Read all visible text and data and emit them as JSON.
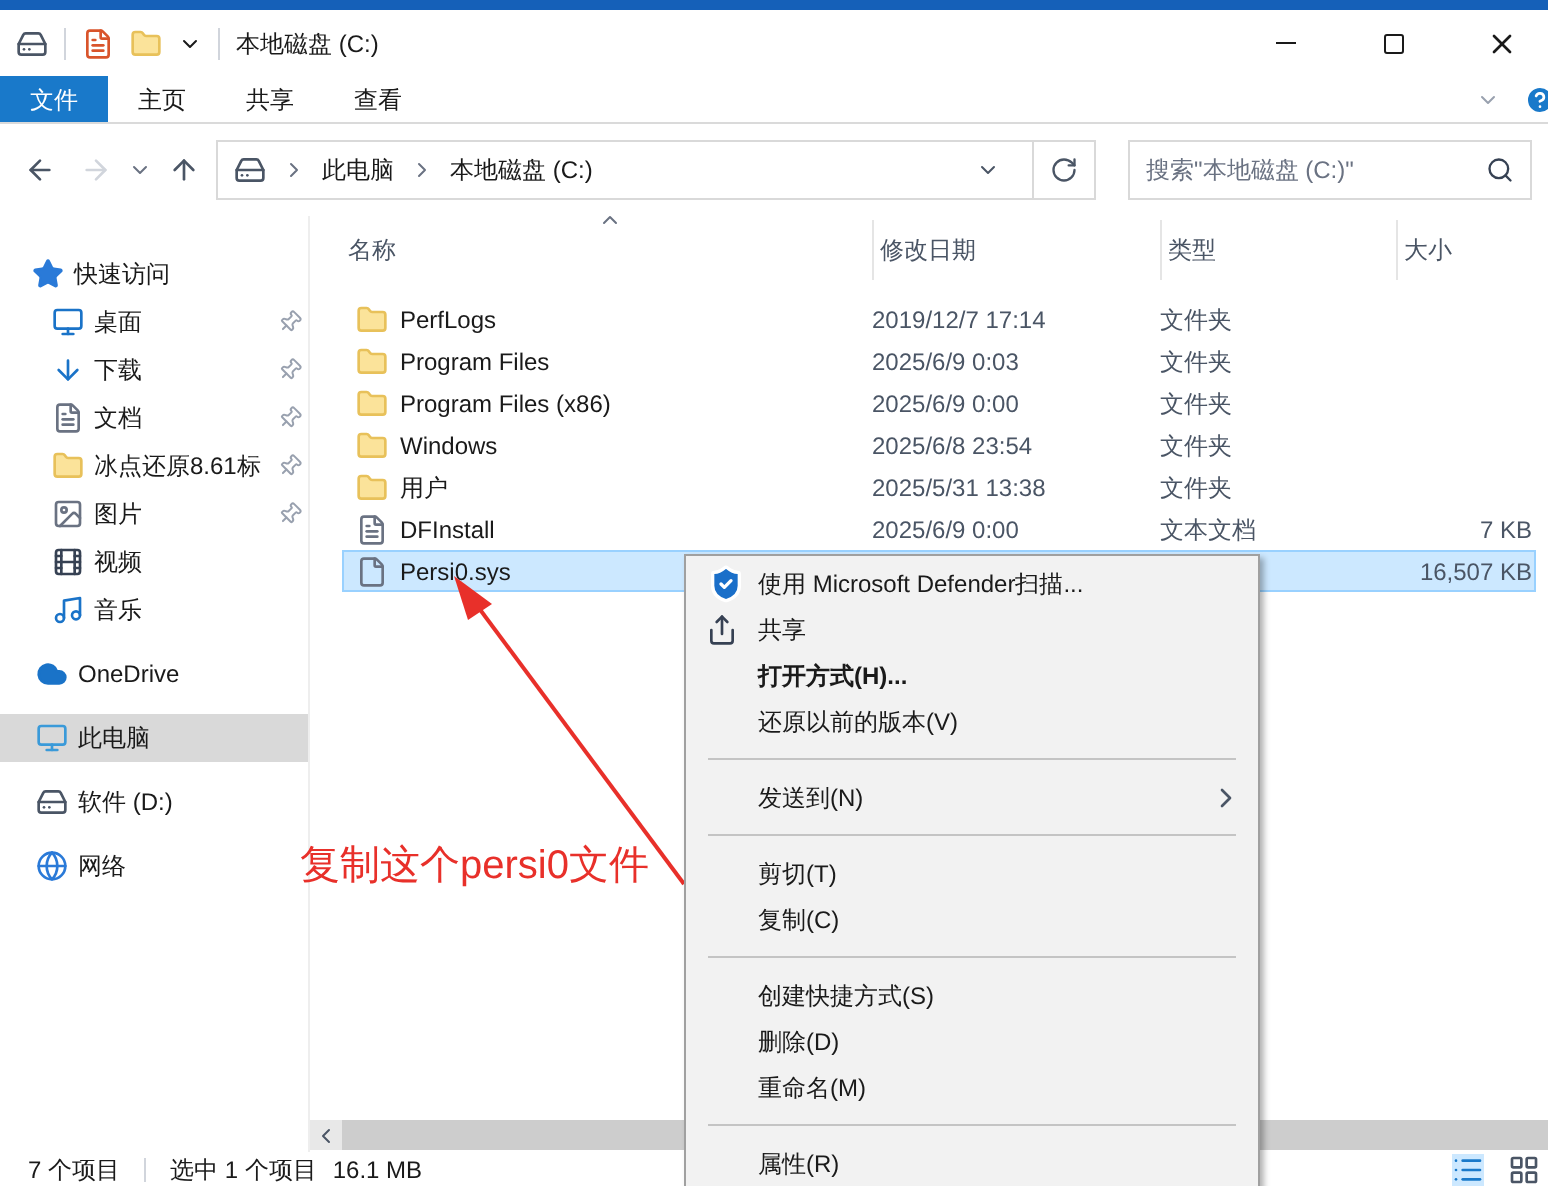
{
  "title_bar": {
    "title": "本地磁盘 (C:)"
  },
  "ribbon": {
    "tabs": [
      {
        "label": "文件",
        "selected": true
      },
      {
        "label": "主页",
        "selected": false
      },
      {
        "label": "共享",
        "selected": false
      },
      {
        "label": "查看",
        "selected": false
      }
    ]
  },
  "address": {
    "crumbs": [
      "此电脑",
      "本地磁盘 (C:)"
    ],
    "search_placeholder": "搜索\"本地磁盘 (C:)\""
  },
  "sidebar": {
    "items": [
      {
        "label": "快速访问",
        "kind": "star",
        "selected": false,
        "children": [
          {
            "label": "桌面",
            "kind": "desktop",
            "pinned": true,
            "selected": false
          },
          {
            "label": "下载",
            "kind": "download",
            "pinned": true,
            "selected": false
          },
          {
            "label": "文档",
            "kind": "document",
            "pinned": true,
            "selected": false
          },
          {
            "label": "冰点还原8.61标",
            "kind": "folder",
            "pinned": true,
            "selected": false
          },
          {
            "label": "图片",
            "kind": "pictures",
            "pinned": true,
            "selected": false
          },
          {
            "label": "视频",
            "kind": "video",
            "pinned": false,
            "selected": false
          },
          {
            "label": "音乐",
            "kind": "music",
            "pinned": false,
            "selected": false
          }
        ]
      },
      {
        "label": "OneDrive",
        "kind": "cloud",
        "selected": false
      },
      {
        "label": "此电脑",
        "kind": "pc",
        "selected": true
      },
      {
        "label": "软件 (D:)",
        "kind": "drive",
        "selected": false
      },
      {
        "label": "网络",
        "kind": "network",
        "selected": false
      }
    ]
  },
  "columns": [
    {
      "label": "名称",
      "sorted": true
    },
    {
      "label": "修改日期",
      "sorted": false
    },
    {
      "label": "类型",
      "sorted": false
    },
    {
      "label": "大小",
      "sorted": false
    }
  ],
  "rows": [
    {
      "name": "PerfLogs",
      "date": "2019/12/7 17:14",
      "type": "文件夹",
      "kind": "folder",
      "selected": false
    },
    {
      "name": "Program Files",
      "date": "2025/6/9 0:03",
      "type": "文件夹",
      "kind": "folder",
      "selected": false
    },
    {
      "name": "Program Files (x86)",
      "date": "2025/6/9 0:00",
      "type": "文件夹",
      "kind": "folder",
      "selected": false
    },
    {
      "name": "Windows",
      "date": "2025/6/8 23:54",
      "type": "文件夹",
      "kind": "folder",
      "selected": false
    },
    {
      "name": "用户",
      "date": "2025/5/31 13:38",
      "type": "文件夹",
      "kind": "folder",
      "selected": false
    },
    {
      "name": "DFInstall",
      "date": "2025/6/9 0:00",
      "type": "文本文档",
      "size": "7 KB",
      "kind": "text",
      "selected": false
    },
    {
      "name": "Persi0.sys",
      "size": "16,507 KB",
      "kind": "system",
      "selected": true
    }
  ],
  "context_menu": {
    "items": [
      {
        "kind": "defender",
        "label": "使用 Microsoft Defender扫描..."
      },
      {
        "kind": "share",
        "label": "共享"
      },
      {
        "kind": "item",
        "label": "打开方式(H)...",
        "bold": true
      },
      {
        "kind": "item",
        "label": "还原以前的版本(V)"
      },
      {
        "kind": "separator"
      },
      {
        "kind": "item",
        "label": "发送到(N)",
        "submenu": true
      },
      {
        "kind": "separator"
      },
      {
        "kind": "item",
        "label": "剪切(T)"
      },
      {
        "kind": "item",
        "label": "复制(C)"
      },
      {
        "kind": "separator"
      },
      {
        "kind": "item",
        "label": "创建快捷方式(S)"
      },
      {
        "kind": "item",
        "label": "删除(D)"
      },
      {
        "kind": "item",
        "label": "重命名(M)"
      },
      {
        "kind": "separator"
      },
      {
        "kind": "item",
        "label": "属性(R)"
      }
    ]
  },
  "annotation": {
    "text": "复制这个persi0文件"
  },
  "status_bar": {
    "count": "7 个项目",
    "selection": "选中 1 个项目",
    "size": "16.1 MB"
  }
}
